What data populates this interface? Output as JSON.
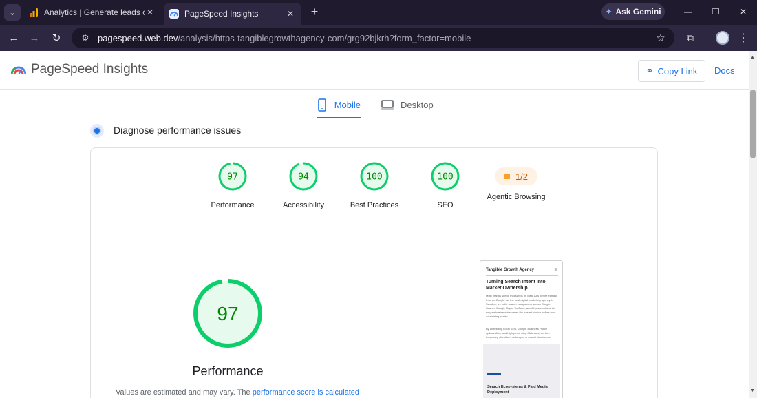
{
  "browser": {
    "tabs": [
      {
        "title": "Analytics | Generate leads overv",
        "icon": "analytics-icon",
        "active": false
      },
      {
        "title": "PageSpeed Insights",
        "icon": "pagespeed-icon",
        "active": true
      }
    ],
    "gemini_label": "Ask Gemini",
    "url_host": "pagespeed.web.dev",
    "url_path": "/analysis/https-tangiblegrowthagency-com/grg92bjkrh?form_factor=mobile"
  },
  "header": {
    "title": "PageSpeed Insights",
    "copy_link": "Copy Link",
    "docs": "Docs"
  },
  "device_tabs": {
    "mobile": "Mobile",
    "desktop": "Desktop",
    "selected": "mobile"
  },
  "diagnose": {
    "title": "Diagnose performance issues"
  },
  "scores": {
    "performance": {
      "value": "97",
      "label": "Performance",
      "fraction": 0.97
    },
    "accessibility": {
      "value": "94",
      "label": "Accessibility",
      "fraction": 0.94
    },
    "best_practices": {
      "value": "100",
      "label": "Best Practices",
      "fraction": 1.0
    },
    "seo": {
      "value": "100",
      "label": "SEO",
      "fraction": 1.0
    },
    "agentic": {
      "value": "1/2",
      "label": "Agentic Browsing"
    }
  },
  "colors": {
    "pass": "#0cce6b",
    "pass_text": "#008800",
    "pass_fill": "#e6fbee",
    "average": "#ffa400",
    "link": "#1a73e8"
  },
  "performance_detail": {
    "score": "97",
    "fraction": 0.97,
    "title": "Performance",
    "note_text": "Values are estimated and may vary. The ",
    "note_link": "performance score is calculated"
  },
  "preview": {
    "brand": "Tangible Growth Agency",
    "heading": "Turning Search Intent Into Market Ownership",
    "para1": "Most brands spend thousands on Meta Ads before earning trust on Google. As the best digital marketing agency in Sweden, we build search ecosystems across Google Search, Google Maps, YouTube, and AI-powered search so your business becomes the trusted choice before your advertising scales.",
    "para2": "By combining Local SEO, Google Business Profile optimization, and high-performing Meta Ads, we turn temporary attention into long-term market dominance.",
    "section_heading": "Search Ecosystems & Paid Media Deployment"
  }
}
